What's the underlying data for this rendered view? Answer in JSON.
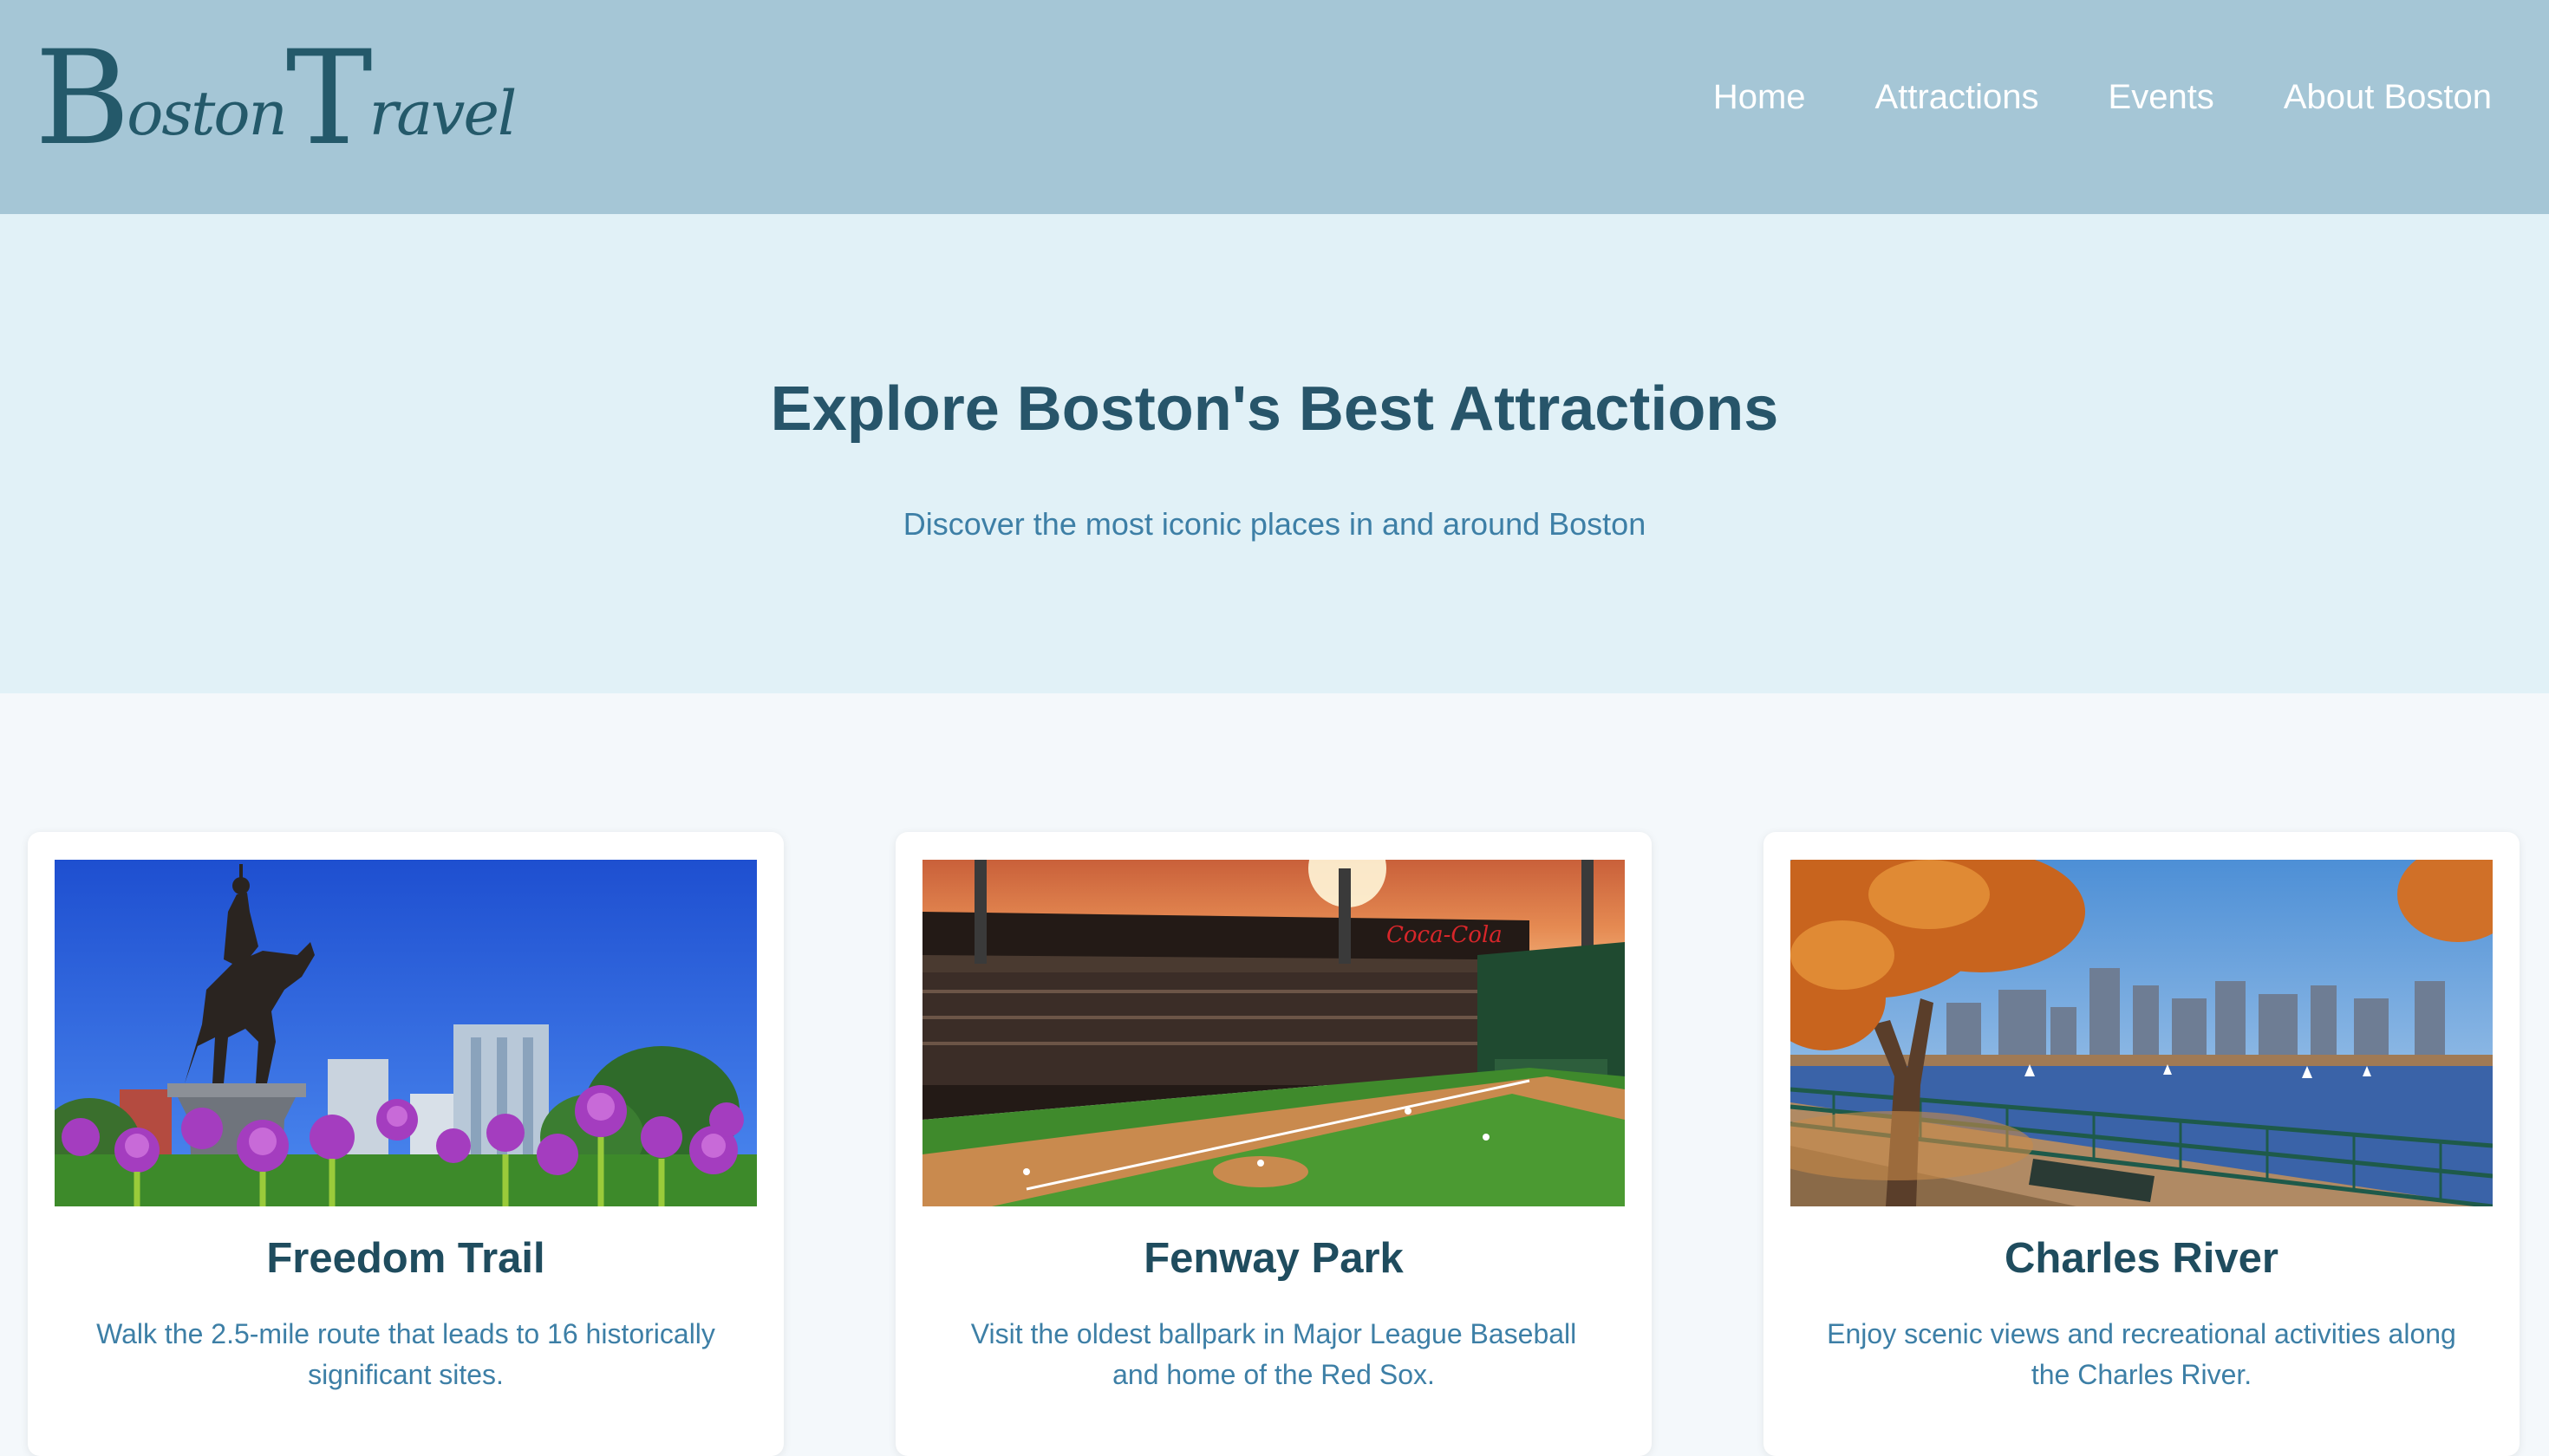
{
  "header": {
    "logo": {
      "cap1": "B",
      "script1": "oston",
      "cap2": "T",
      "script2": "ravel"
    },
    "nav": [
      "Home",
      "Attractions",
      "Events",
      "About Boston"
    ]
  },
  "hero": {
    "title": "Explore Boston's Best Attractions",
    "subtitle": "Discover the most iconic places in and around Boston"
  },
  "cards": [
    {
      "title": "Freedom Trail",
      "description": "Walk the 2.5-mile route that leads to 16 historically significant sites.",
      "image": "statue-and-flowers-photo"
    },
    {
      "title": "Fenway Park",
      "description": "Visit the oldest ballpark in Major League Baseball and home of the Red Sox.",
      "image": "baseball-stadium-photo"
    },
    {
      "title": "Charles River",
      "description": "Enjoy scenic views and recreational activities along the Charles River.",
      "image": "river-skyline-photo"
    }
  ],
  "colors": {
    "header_bg": "#a5c6d6",
    "hero_bg": "#e1f1f7",
    "heading": "#27556a",
    "accent": "#3d7fa6"
  }
}
